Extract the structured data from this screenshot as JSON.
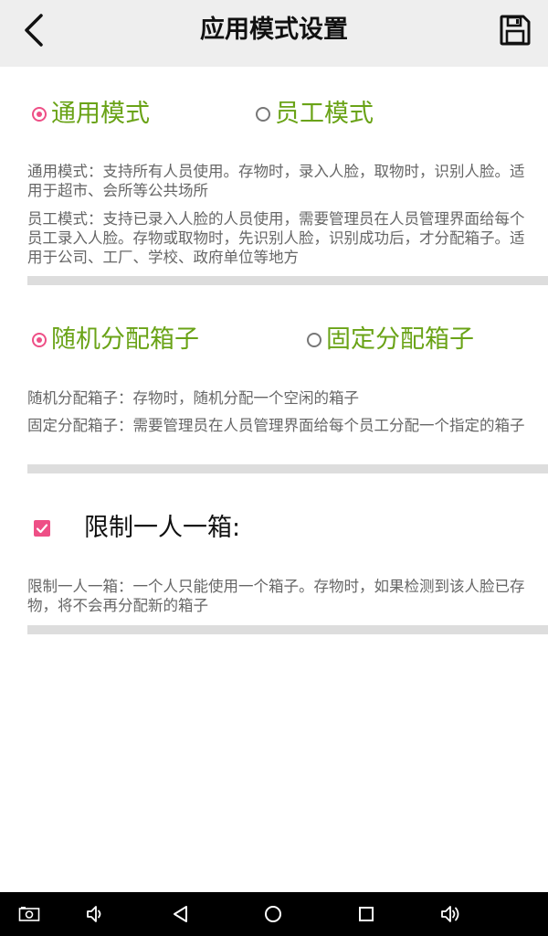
{
  "header": {
    "title": "应用模式设置",
    "back_icon": "chevron-left-icon",
    "save_icon": "floppy-disk-save-icon"
  },
  "mode": {
    "options": [
      {
        "label": "通用模式",
        "checked": true
      },
      {
        "label": "员工模式",
        "checked": false
      }
    ],
    "desc_general": "通用模式：支持所有人员使用。存物时，录入人脸，取物时，识别人脸。适用于超市、会所等公共场所",
    "desc_staff": "员工模式：支持已录入人脸的人员使用，需要管理员在人员管理界面给每个员工录入人脸。存物或取物时，先识别人脸，识别成功后，才分配箱子。适用于公司、工厂、学校、政府单位等地方"
  },
  "assign": {
    "options": [
      {
        "label": "随机分配箱子",
        "checked": true
      },
      {
        "label": "固定分配箱子",
        "checked": false
      }
    ],
    "desc_random": "随机分配箱子：存物时，随机分配一个空闲的箱子",
    "desc_fixed": "固定分配箱子：需要管理员在人员管理界面给每个员工分配一个指定的箱子"
  },
  "limit": {
    "label": "限制一人一箱:",
    "checked": true,
    "desc": "限制一人一箱：一个人只能使用一个箱子。存物时，如果检测到该人脸已存物，将不会再分配新的箱子"
  },
  "colors": {
    "accent": "#ee4f86",
    "label_green": "#6aa317",
    "header_bg": "#eeeeee",
    "navbar_bg": "#000000"
  },
  "navbar": {
    "icons": [
      "screenshot-icon",
      "volume-down-icon",
      "back-triangle-icon",
      "home-circle-icon",
      "recents-square-icon",
      "volume-up-icon"
    ]
  }
}
